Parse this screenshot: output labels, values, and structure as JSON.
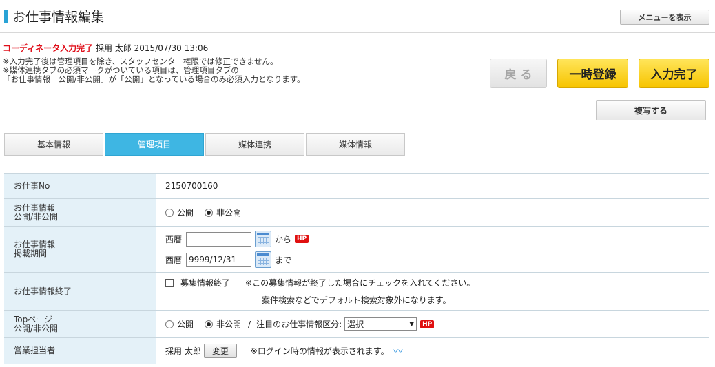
{
  "header": {
    "title": "お仕事情報編集",
    "menu_button": "メニューを表示"
  },
  "status": {
    "label": "コーディネータ入力完了",
    "user": "採用 太郎",
    "timestamp": "2015/07/30 13:06"
  },
  "notes": [
    "※入力完了後は管理項目を除き、スタッフセンター権限では修正できません。",
    "※媒体連携タブの必須マークがついている項目は、管理項目タブの",
    "「お仕事情報　公開/非公開」が「公開」となっている場合のみ必須入力となります。"
  ],
  "actions": {
    "back": "戻 る",
    "temp_save": "一時登録",
    "complete": "入力完了",
    "copy": "複写する"
  },
  "tabs": [
    {
      "label": "基本情報",
      "active": false
    },
    {
      "label": "管理項目",
      "active": true
    },
    {
      "label": "媒体連携",
      "active": false
    },
    {
      "label": "媒体情報",
      "active": false
    }
  ],
  "fields": {
    "job_no": {
      "label": "お仕事No",
      "value": "2150700160"
    },
    "visibility": {
      "label_line1": "お仕事情報",
      "label_line2": "公開/非公開",
      "opt_public": "公開",
      "opt_private": "非公開",
      "selected": "非公開"
    },
    "period": {
      "label_line1": "お仕事情報",
      "label_line2": "掲載期間",
      "era": "西暦",
      "start_value": "",
      "from_text": "から",
      "end_value": "9999/12/31",
      "until_text": "まで",
      "hp_badge": "HP"
    },
    "end": {
      "label": "お仕事情報終了",
      "checkbox_label": "募集情報終了",
      "checked": false,
      "note1": "※この募集情報が終了した場合にチェックを入れてください。",
      "note2": "案件検索などでデフォルト検索対象外になります。"
    },
    "top_page": {
      "label_line1": "Topページ",
      "label_line2": "公開/非公開",
      "opt_public": "公開",
      "opt_private": "非公開",
      "selected": "非公開",
      "separator": "/",
      "category_label": "注目のお仕事情報区分:",
      "category_value": "選択",
      "hp_badge": "HP"
    },
    "sales": {
      "label": "営業担当者",
      "value": "採用 太郎",
      "change_button": "変更",
      "note": "※ログイン時の情報が表示されます。"
    }
  },
  "colors": {
    "accent": "#29a3d6",
    "active_tab": "#3eb6e3",
    "status_red": "#e0101b",
    "yellow_button": "#f7c400",
    "label_bg": "#e4f1f8"
  }
}
